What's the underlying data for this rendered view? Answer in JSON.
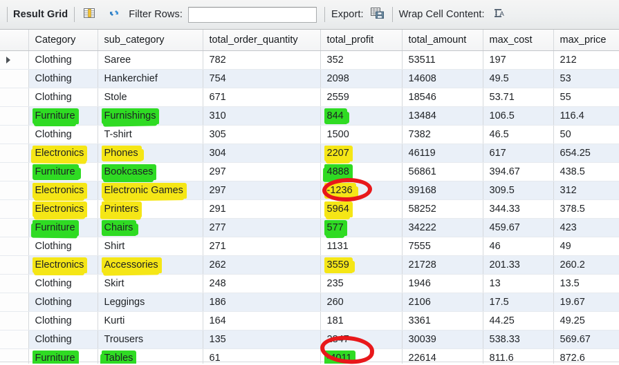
{
  "toolbar": {
    "result_grid_label": "Result Grid",
    "grid_icon": "grid-view-icon",
    "refresh_icon": "refresh-icon",
    "filter_label": "Filter Rows:",
    "filter_value": "",
    "filter_placeholder": "",
    "export_label": "Export:",
    "export_icon": "export-save-icon",
    "wrap_label": "Wrap Cell Content:",
    "wrap_icon": "wrap-text-icon"
  },
  "grid": {
    "columns": [
      "Category",
      "sub_category",
      "total_order_quantity",
      "total_profit",
      "total_amount",
      "max_cost",
      "max_price"
    ],
    "selected_row_index": 0,
    "rows": [
      {
        "category": "Clothing",
        "sub_category": "Saree",
        "total_order_quantity": "782",
        "total_profit": "352",
        "total_amount": "53511",
        "max_cost": "197",
        "max_price": "212"
      },
      {
        "category": "Clothing",
        "sub_category": "Hankerchief",
        "total_order_quantity": "754",
        "total_profit": "2098",
        "total_amount": "14608",
        "max_cost": "49.5",
        "max_price": "53"
      },
      {
        "category": "Clothing",
        "sub_category": "Stole",
        "total_order_quantity": "671",
        "total_profit": "2559",
        "total_amount": "18546",
        "max_cost": "53.71",
        "max_price": "55"
      },
      {
        "category": "Furniture",
        "sub_category": "Furnishings",
        "total_order_quantity": "310",
        "total_profit": "844",
        "total_amount": "13484",
        "max_cost": "106.5",
        "max_price": "116.4"
      },
      {
        "category": "Clothing",
        "sub_category": "T-shirt",
        "total_order_quantity": "305",
        "total_profit": "1500",
        "total_amount": "7382",
        "max_cost": "46.5",
        "max_price": "50"
      },
      {
        "category": "Electronics",
        "sub_category": "Phones",
        "total_order_quantity": "304",
        "total_profit": "2207",
        "total_amount": "46119",
        "max_cost": "617",
        "max_price": "654.25"
      },
      {
        "category": "Furniture",
        "sub_category": "Bookcases",
        "total_order_quantity": "297",
        "total_profit": "4888",
        "total_amount": "56861",
        "max_cost": "394.67",
        "max_price": "438.5"
      },
      {
        "category": "Electronics",
        "sub_category": "Electronic Games",
        "total_order_quantity": "297",
        "total_profit": "-1236",
        "total_amount": "39168",
        "max_cost": "309.5",
        "max_price": "312"
      },
      {
        "category": "Electronics",
        "sub_category": "Printers",
        "total_order_quantity": "291",
        "total_profit": "5964",
        "total_amount": "58252",
        "max_cost": "344.33",
        "max_price": "378.5"
      },
      {
        "category": "Furniture",
        "sub_category": "Chairs",
        "total_order_quantity": "277",
        "total_profit": "577",
        "total_amount": "34222",
        "max_cost": "459.67",
        "max_price": "423"
      },
      {
        "category": "Clothing",
        "sub_category": "Shirt",
        "total_order_quantity": "271",
        "total_profit": "1131",
        "total_amount": "7555",
        "max_cost": "46",
        "max_price": "49"
      },
      {
        "category": "Electronics",
        "sub_category": "Accessories",
        "total_order_quantity": "262",
        "total_profit": "3559",
        "total_amount": "21728",
        "max_cost": "201.33",
        "max_price": "260.2"
      },
      {
        "category": "Clothing",
        "sub_category": "Skirt",
        "total_order_quantity": "248",
        "total_profit": "235",
        "total_amount": "1946",
        "max_cost": "13",
        "max_price": "13.5"
      },
      {
        "category": "Clothing",
        "sub_category": "Leggings",
        "total_order_quantity": "186",
        "total_profit": "260",
        "total_amount": "2106",
        "max_cost": "17.5",
        "max_price": "19.67"
      },
      {
        "category": "Clothing",
        "sub_category": "Kurti",
        "total_order_quantity": "164",
        "total_profit": "181",
        "total_amount": "3361",
        "max_cost": "44.25",
        "max_price": "49.25"
      },
      {
        "category": "Clothing",
        "sub_category": "Trousers",
        "total_order_quantity": "135",
        "total_profit": "2847",
        "total_amount": "30039",
        "max_cost": "538.33",
        "max_price": "569.67"
      },
      {
        "category": "Furniture",
        "sub_category": "Tables",
        "total_order_quantity": "61",
        "total_profit": "-4011",
        "total_amount": "22614",
        "max_cost": "811.6",
        "max_price": "872.6"
      }
    ],
    "highlights": {
      "green_rows": [
        3,
        6,
        9,
        16
      ],
      "yellow_rows": [
        5,
        7,
        8,
        11
      ],
      "green_columns": [
        "category",
        "sub_category",
        "total_profit"
      ],
      "yellow_columns": [
        "category",
        "sub_category",
        "total_profit"
      ],
      "circled_cells": [
        "row7.total_profit",
        "row16.total_profit"
      ],
      "colors": {
        "green": "#2fdb23",
        "yellow": "#f5e616",
        "circle_red": "#e8181b"
      }
    }
  }
}
